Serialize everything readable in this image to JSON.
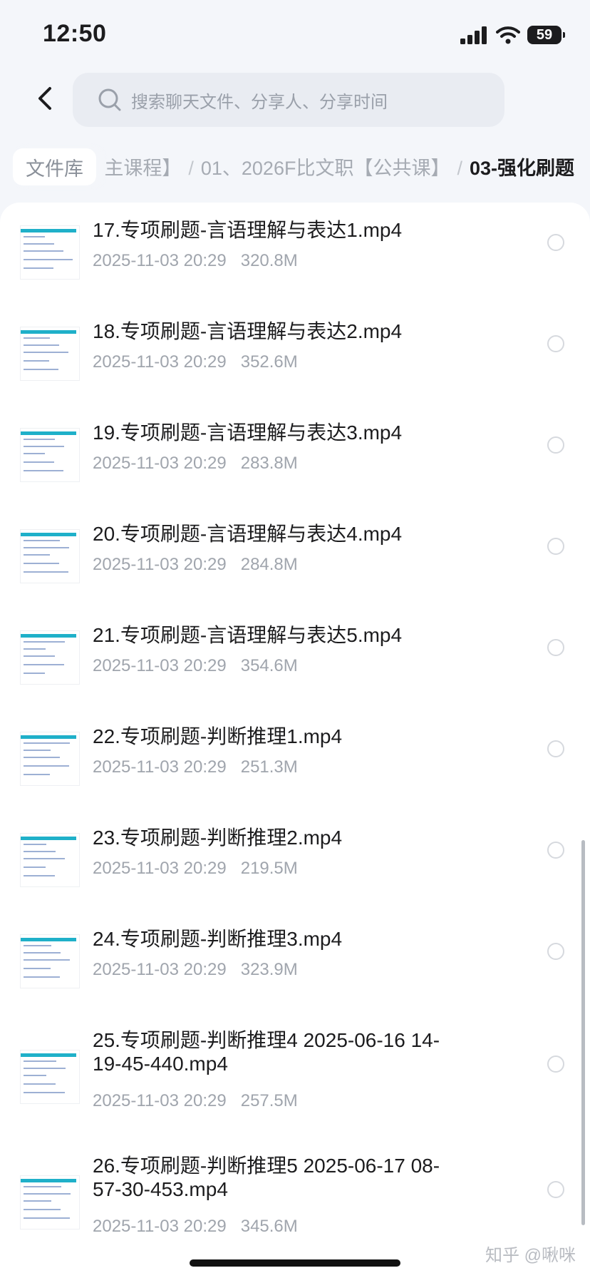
{
  "status_bar": {
    "time": "12:50",
    "battery": "59"
  },
  "search": {
    "placeholder": "搜索聊天文件、分享人、分享时间"
  },
  "breadcrumb": {
    "home": "文件库",
    "parts": [
      "主课程】",
      "01、2026F比文职【公共课】"
    ],
    "current": "03-强化刷题"
  },
  "files": [
    {
      "name": "17.专项刷题-言语理解与表达1.mp4",
      "date": "2025-11-03 20:29",
      "size": "320.8M"
    },
    {
      "name": "18.专项刷题-言语理解与表达2.mp4",
      "date": "2025-11-03 20:29",
      "size": "352.6M"
    },
    {
      "name": "19.专项刷题-言语理解与表达3.mp4",
      "date": "2025-11-03 20:29",
      "size": "283.8M"
    },
    {
      "name": "20.专项刷题-言语理解与表达4.mp4",
      "date": "2025-11-03 20:29",
      "size": "284.8M"
    },
    {
      "name": "21.专项刷题-言语理解与表达5.mp4",
      "date": "2025-11-03 20:29",
      "size": "354.6M"
    },
    {
      "name": "22.专项刷题-判断推理1.mp4",
      "date": "2025-11-03 20:29",
      "size": "251.3M"
    },
    {
      "name": "23.专项刷题-判断推理2.mp4",
      "date": "2025-11-03 20:29",
      "size": "219.5M"
    },
    {
      "name": "24.专项刷题-判断推理3.mp4",
      "date": "2025-11-03 20:29",
      "size": "323.9M"
    },
    {
      "name": "25.专项刷题-判断推理4 2025-06-16 14-19-45-440.mp4",
      "date": "2025-11-03 20:29",
      "size": "257.5M"
    },
    {
      "name": "26.专项刷题-判断推理5 2025-06-17 08-57-30-453.mp4",
      "date": "2025-11-03 20:29",
      "size": "345.6M"
    }
  ],
  "watermark": "知乎 @啾咪"
}
